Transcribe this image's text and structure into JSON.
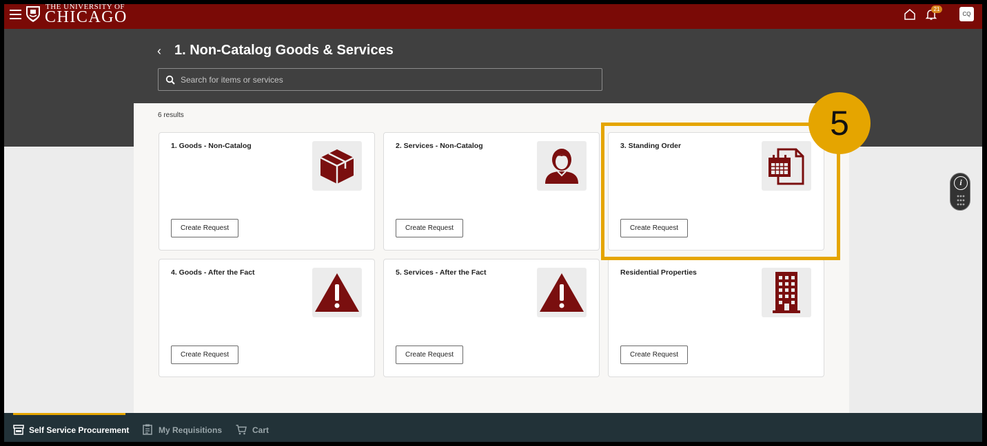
{
  "header": {
    "logo_small": "THE UNIVERSITY OF",
    "logo_big": "CHICAGO",
    "notification_count": "21",
    "avatar_initials": "CQ"
  },
  "page": {
    "title": "1. Non-Catalog Goods & Services",
    "search_placeholder": "Search for items or services",
    "results_text": "6 results"
  },
  "cards": [
    {
      "title": "1. Goods - Non-Catalog",
      "icon": "box-icon",
      "button": "Create Request"
    },
    {
      "title": "2. Services - Non-Catalog",
      "icon": "person-icon",
      "button": "Create Request"
    },
    {
      "title": "3. Standing Order",
      "icon": "calendar-document-icon",
      "button": "Create Request"
    },
    {
      "title": "4. Goods - After the Fact",
      "icon": "warning-icon",
      "button": "Create Request"
    },
    {
      "title": "5. Services - After the Fact",
      "icon": "warning-icon",
      "button": "Create Request"
    },
    {
      "title": "Residential Properties",
      "icon": "building-icon",
      "button": "Create Request"
    }
  ],
  "annotation": {
    "step_number": "5",
    "color": "#e5a500"
  },
  "bottom_nav": [
    {
      "label": "Self Service Procurement",
      "icon": "store-icon",
      "active": true
    },
    {
      "label": "My Requisitions",
      "icon": "clipboard-icon",
      "active": false
    },
    {
      "label": "Cart",
      "icon": "cart-icon",
      "active": false
    }
  ],
  "colors": {
    "brand": "#7a0a06",
    "icon_maroon": "#7a0f0f",
    "accent": "#e5a500"
  }
}
